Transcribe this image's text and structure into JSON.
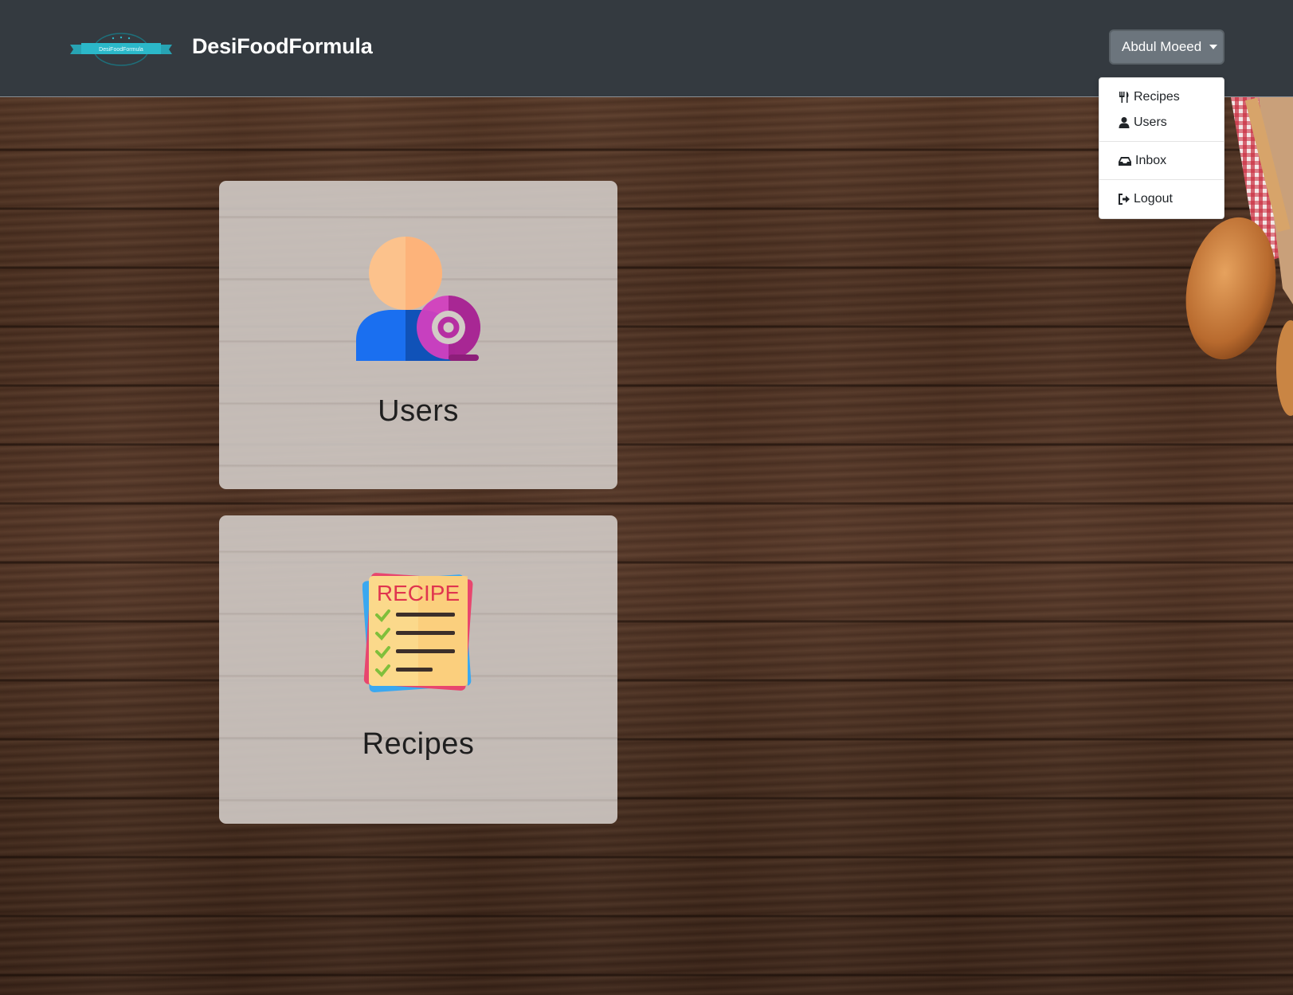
{
  "brand": {
    "logo_alt": "DesiFoodFormula",
    "name": "DesiFoodFormula"
  },
  "user_menu": {
    "label": "Abdul Moeed",
    "items": [
      {
        "label": "Recipes",
        "icon": "utensils-icon"
      },
      {
        "label": "Users",
        "icon": "user-icon"
      },
      {
        "label": "Inbox",
        "icon": "inbox-icon"
      },
      {
        "label": "Logout",
        "icon": "logout-icon"
      }
    ]
  },
  "cards": [
    {
      "title": "Users",
      "icon": "user-email-icon"
    },
    {
      "title": "Recipes",
      "icon": "recipe-list-icon",
      "icon_text": "RECIPE"
    }
  ],
  "colors": {
    "navbar": "#343a40",
    "dropdown_button": "#6c757d",
    "card": "#d2cbc6"
  }
}
